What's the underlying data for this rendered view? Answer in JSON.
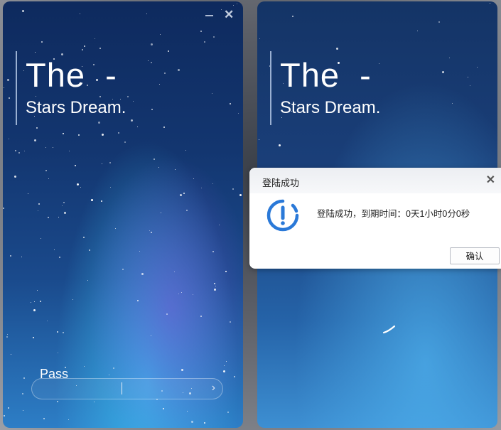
{
  "left_panel": {
    "brand_title": "The  -",
    "brand_subtitle": "Stars Dream.",
    "password_label": "Pass",
    "submit_arrow": "›"
  },
  "right_panel": {
    "brand_title": "The  -",
    "brand_subtitle": "Stars Dream."
  },
  "window_controls": {
    "close_glyph": "✕"
  },
  "dialog": {
    "title": "登陆成功",
    "close_glyph": "✕",
    "message": "登陆成功，到期时间：0天1小时0分0秒",
    "confirm_label": "确认",
    "icon": "info-icon",
    "accent": "#2a79d8"
  }
}
